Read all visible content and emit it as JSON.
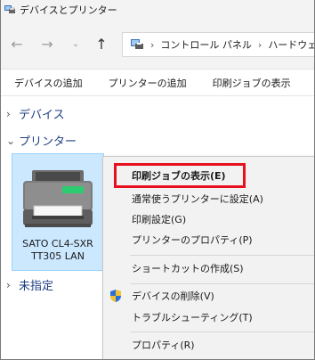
{
  "window": {
    "title": "デバイスとプリンター",
    "title_icon": "devices-printers-icon"
  },
  "nav": {
    "back_icon": "arrow-left-icon",
    "forward_icon": "arrow-right-icon",
    "recent_icon": "chevron-down-icon",
    "up_icon": "arrow-up-icon",
    "breadcrumb": [
      "コントロール パネル",
      "ハードウェアと"
    ]
  },
  "commands": {
    "add_device": "デバイスの追加",
    "add_printer": "プリンターの追加",
    "see_print_jobs": "印刷ジョブの表示",
    "overflow": "プ"
  },
  "groups": {
    "devices": "デバイス",
    "printers": "プリンター",
    "unspecified": "未指定"
  },
  "printer": {
    "name_line1": "SATO CL4-SXR",
    "name_line2": "TT305 LAN"
  },
  "context_menu": {
    "see_print_jobs": "印刷ジョブの表示(E)",
    "set_default": "通常使うプリンターに設定(A)",
    "printing_preferences": "印刷設定(G)",
    "printer_properties": "プリンターのプロパティ(P)",
    "create_shortcut": "ショートカットの作成(S)",
    "remove_device": "デバイスの削除(V)",
    "troubleshoot": "トラブルシューティング(T)",
    "properties": "プロパティ(R)"
  },
  "colors": {
    "selection_bg": "#cce8ff",
    "highlight_border": "#e8101e",
    "group_text": "#1e3f86"
  }
}
